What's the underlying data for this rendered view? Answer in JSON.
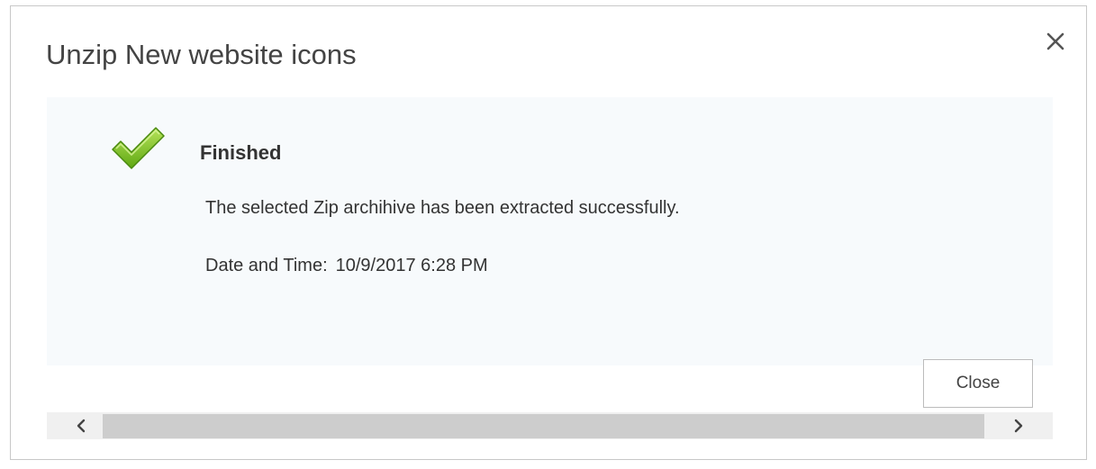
{
  "dialog": {
    "title": "Unzip New website icons",
    "close_icon": "close-x-icon"
  },
  "content": {
    "status_icon": "check-mark-icon",
    "status_color": "#7cc21d",
    "heading": "Finished",
    "message": "The selected Zip archihive has been extracted successfully.",
    "datetime_label": "Date and Time:",
    "datetime_value": "10/9/2017 6:28 PM"
  },
  "footer": {
    "close_label": "Close"
  },
  "scrollbar": {
    "left_icon": "chevron-left-icon",
    "right_icon": "chevron-right-icon"
  }
}
